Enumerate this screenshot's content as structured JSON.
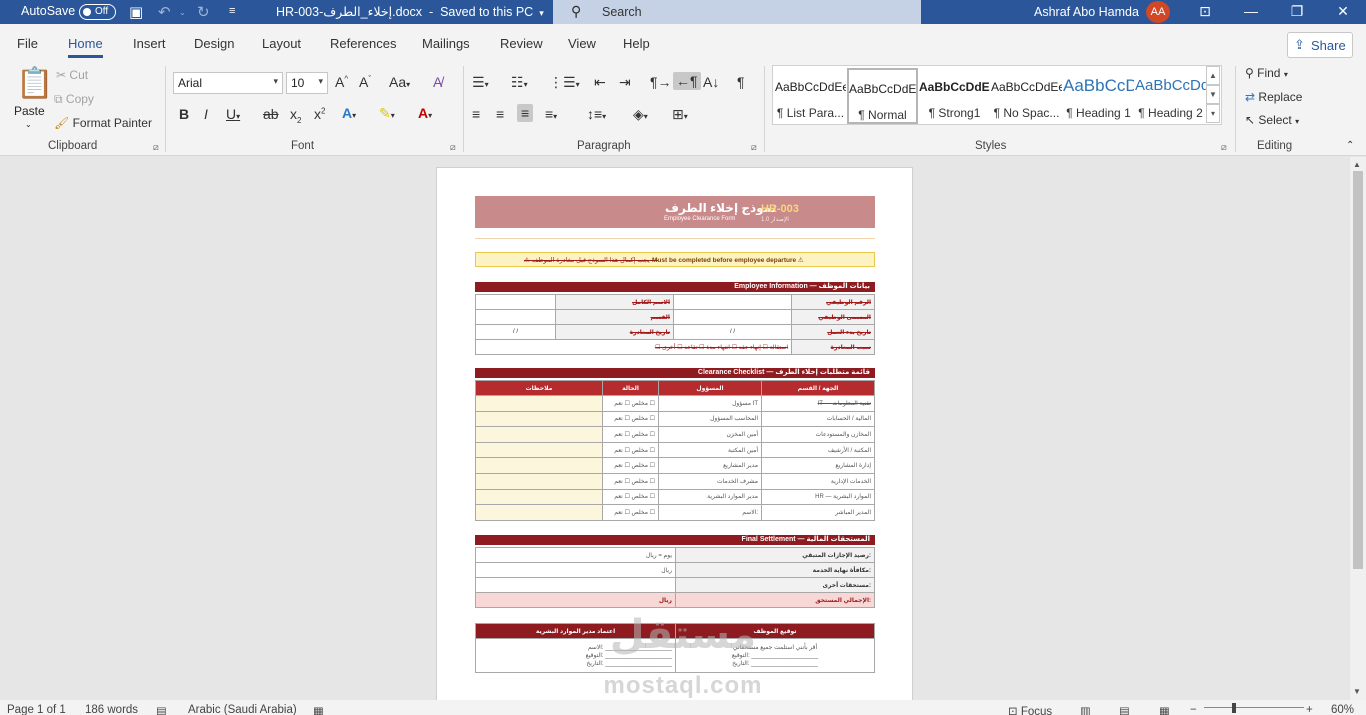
{
  "titlebar": {
    "autosave": "AutoSave",
    "autosave_state": "Off",
    "doc_name": "HR-003-إخلاء_الطرف.docx",
    "saved": "Saved to this PC",
    "search_placeholder": "Search",
    "user_name": "Ashraf Abo Hamda",
    "user_initials": "AA"
  },
  "menu": {
    "tabs": [
      "File",
      "Home",
      "Insert",
      "Design",
      "Layout",
      "References",
      "Mailings",
      "Review",
      "View",
      "Help"
    ],
    "share": "Share"
  },
  "ribbon": {
    "clipboard": {
      "paste": "Paste",
      "cut": "Cut",
      "copy": "Copy",
      "format_painter": "Format Painter",
      "label": "Clipboard"
    },
    "font": {
      "font_name": "Arial",
      "font_size": "10",
      "label": "Font"
    },
    "paragraph": {
      "label": "Paragraph"
    },
    "styles": {
      "label": "Styles",
      "items": [
        {
          "sample": "AaBbCcDdEe",
          "name": "¶ List Para..."
        },
        {
          "sample": "AaBbCcDdEe",
          "name": "¶ Normal"
        },
        {
          "sample": "AaBbCcDdEe",
          "name": "¶ Strong1"
        },
        {
          "sample": "AaBbCcDdEe",
          "name": "¶ No Spac..."
        },
        {
          "sample": "AaBbCcDdEe",
          "name": "¶ Heading 1"
        },
        {
          "sample": "AaBbCcDdEe",
          "name": "¶ Heading 2"
        }
      ]
    },
    "editing": {
      "find": "Find",
      "replace": "Replace",
      "select": "Select",
      "label": "Editing"
    }
  },
  "document": {
    "header_title_ar": "نموذج إخلاء الطرف",
    "header_title_en": "Employee Clearance Form",
    "header_code": "HR-003",
    "header_version": "الإصدار 1.0",
    "warning_ar": "يجب إكمال هذا النموذج قبل مغادرة الموظف",
    "warning_en": "Must be completed before employee departure",
    "sec_employee": "Employee Information — بيانات الموظف",
    "emp_labels_right": [
      "الرقم الوظيفي",
      "المسمى الوظيفي",
      "تاريخ بدء العمل",
      "سبب المغادرة"
    ],
    "emp_labels_left": [
      "الاسم الكامل",
      "القسم",
      "تاريخ المغادرة"
    ],
    "date_placeholder": "/          /",
    "reasons": "☐ استقالة   ☐ إنهاء عقد   ☐ انتهاء مدة   ☐ تقاعد   ☐ أخرى",
    "sec_clearance": "Clearance Checklist — قائمة متطلبات إخلاء الطرف",
    "clearance_headers": [
      "ملاحظات",
      "الحالة",
      "المسؤول",
      "الجهة / القسم"
    ],
    "clearance_rows": [
      {
        "dept": "IT — تقنية المعلومات",
        "owner": "مسؤول IT",
        "status": "مخلص ☐ نعم ☐"
      },
      {
        "dept": "المالية / الحسابات",
        "owner": "المحاسب المسؤول",
        "status": "مخلص ☐ نعم ☐"
      },
      {
        "dept": "المخازن والمستودعات",
        "owner": "أمين المخزن",
        "status": "مخلص ☐ نعم ☐"
      },
      {
        "dept": "المكتبة / الأرشيف",
        "owner": "أمين المكتبة",
        "status": "مخلص ☐ نعم ☐"
      },
      {
        "dept": "إدارة المشاريع",
        "owner": "مدير المشاريع",
        "status": "مخلص ☐ نعم ☐"
      },
      {
        "dept": "الخدمات الإدارية",
        "owner": "مشرف الخدمات",
        "status": "مخلص ☐ نعم ☐"
      },
      {
        "dept": "HR — الموارد البشرية",
        "owner": "مدير الموارد البشرية",
        "status": "مخلص ☐ نعم ☐"
      },
      {
        "dept": "المدير المباشر",
        "owner": "الاسم:",
        "status": "مخلص ☐ نعم ☐"
      }
    ],
    "sec_settlement": "Final Settlement — المستحقات المالية",
    "settlement_rows": [
      {
        "label": "رصيد الإجازات المتبقي:",
        "value": "يوم          = ريال"
      },
      {
        "label": "مكافأة نهاية الخدمة:",
        "value": "ريال"
      },
      {
        "label": "مستحقات أخرى:",
        "value": ""
      },
      {
        "label": "الإجمالي المستحق:",
        "value": "ريال"
      }
    ],
    "sig_hr": "اعتماد مدير الموارد البشرية",
    "sig_emp": "توقيع الموظف",
    "sig_emp_note": "أقر بأنني استلمت جميع مستحقاتي",
    "sig_name": "الاسم: ____________________",
    "sig_sign": "التوقيع: ____________________",
    "sig_date": "التاريخ: ____________________"
  },
  "watermark": {
    "ar": "مستقل",
    "en": "mostaql.com"
  },
  "statusbar": {
    "page": "Page 1 of 1",
    "words": "186 words",
    "language": "Arabic (Saudi Arabia)",
    "focus": "Focus",
    "zoom": "60%"
  },
  "colors": {
    "accent": "#2b579a",
    "header_band": "#c98a8c",
    "section": "#8e1b1f",
    "table_header": "#b62b2e"
  }
}
